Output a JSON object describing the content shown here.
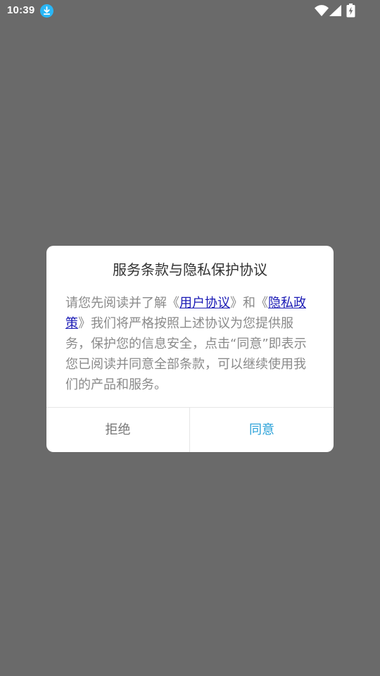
{
  "status_bar": {
    "time": "10:39",
    "icons": [
      "download-icon",
      "wifi-icon",
      "signal-icon",
      "battery-charging-icon"
    ]
  },
  "dialog": {
    "title": "服务条款与隐私保护协议",
    "body": {
      "intro": "请您先阅读并了解《",
      "user_agreement_link": "用户协议",
      "mid": "》和《",
      "privacy_policy_link": "隐私政策",
      "rest": "》我们将严格按照上述协议为您提供服务，保护您的信息安全，点击“同意”即表示您已阅读并同意全部条款，可以继续使用我们的产品和服务。"
    },
    "reject_label": "拒绝",
    "agree_label": "同意"
  },
  "colors": {
    "overlay": "#6a6a6a",
    "link": "#1a1ab5",
    "agree": "#2aa1d8",
    "body_text": "#8a8a8a",
    "download_badge": "#29b6f6"
  }
}
